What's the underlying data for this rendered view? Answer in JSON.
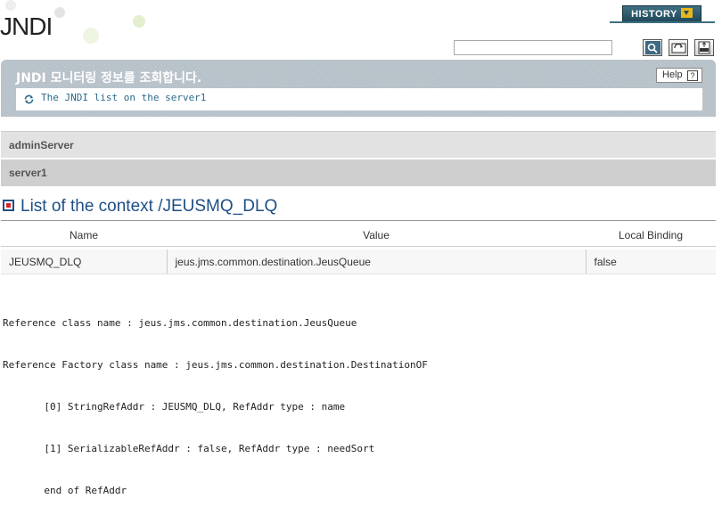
{
  "page": {
    "title": "JNDI"
  },
  "header": {
    "history_label": "HISTORY"
  },
  "search": {
    "value": ""
  },
  "info": {
    "title": "JNDI 모니터링 정보를 조회합니다.",
    "help_label": "Help",
    "help_glyph": "?",
    "link_text": "The JNDI list on the server1"
  },
  "servers": [
    {
      "name": "adminServer"
    },
    {
      "name": "server1"
    }
  ],
  "context": {
    "title": "List of the context /JEUSMQ_DLQ",
    "columns": [
      "Name",
      "Value",
      "Local Binding"
    ],
    "rows": [
      {
        "name": "JEUSMQ_DLQ",
        "value": "jeus.jms.common.destination.JeusQueue",
        "local_binding": "false"
      }
    ]
  },
  "reference": {
    "lines": [
      "Reference class name : jeus.jms.common.destination.JeusQueue",
      "Reference Factory class name : jeus.jms.common.destination.DestinationOF",
      "       [0] StringRefAddr : JEUSMQ_DLQ, RefAddr type : name",
      "       [1] SerializableRefAddr : false, RefAddr type : needSort",
      "       end of RefAddr"
    ]
  },
  "colors": {
    "accent": "#1e4f86",
    "link": "#2a6b8a",
    "history": "#1f4757"
  }
}
